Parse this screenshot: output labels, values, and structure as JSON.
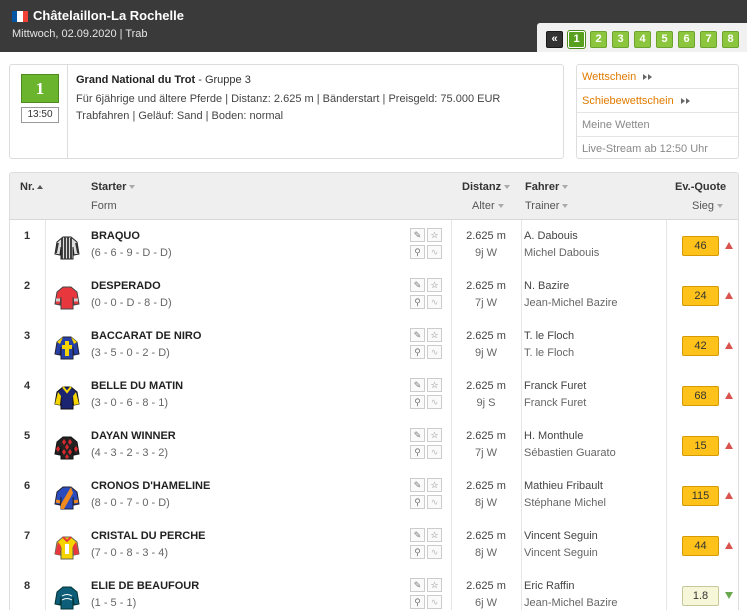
{
  "header": {
    "venue": "Châtelaillon-La Rochelle",
    "subline": "Mittwoch, 02.09.2020  |  Trab",
    "flag_colors": [
      "#0055a4",
      "#ffffff",
      "#ef4135"
    ],
    "prev_label": "«",
    "race_numbers": [
      "1",
      "2",
      "3",
      "4",
      "5",
      "6",
      "7",
      "8"
    ],
    "active_race": "1"
  },
  "race": {
    "number": "1",
    "time": "13:50",
    "title": "Grand National du Trot",
    "group": " - Gruppe 3",
    "line2": "Für 6jährige und ältere Pferde  |  Distanz: 2.625 m  |  Bänderstart  |  Preisgeld: 75.000 EUR",
    "line3": "Trabfahren  |  Geläuf: Sand  |  Boden: normal"
  },
  "sidebar": {
    "items": [
      {
        "label": "Wettschein",
        "style": "orange",
        "icon": "double-chevron-right-icon"
      },
      {
        "label": "Schiebewettschein",
        "style": "orange",
        "icon": "double-chevron-right-icon"
      },
      {
        "label": "Meine Wetten",
        "style": "gray"
      },
      {
        "label": "Live-Stream ab 12:50 Uhr",
        "style": "gray"
      }
    ]
  },
  "table": {
    "headers": {
      "nr": "Nr.",
      "starter": "Starter",
      "form": "Form",
      "distanz": "Distanz",
      "alter": "Alter",
      "fahrer": "Fahrer",
      "trainer": "Trainer",
      "quote": "Ev.-Quote",
      "sieg": "Sieg"
    },
    "rows": [
      {
        "nr": "1",
        "name": "BRAQUO",
        "form": "(6 - 6 - 9 - D - D)",
        "dist": "2.625 m",
        "age": "9j W",
        "driver": "A. Dabouis",
        "trainer": "Michel Dabouis",
        "odds": "46",
        "trend": "up",
        "silk": "stripes"
      },
      {
        "nr": "2",
        "name": "DESPERADO",
        "form": "(0 - 0 - D - 8 - D)",
        "dist": "2.625 m",
        "age": "7j W",
        "driver": "N. Bazire",
        "trainer": "Jean-Michel Bazire",
        "odds": "24",
        "trend": "up",
        "silk": "red"
      },
      {
        "nr": "3",
        "name": "BACCARAT DE NIRO",
        "form": "(3 - 5 - 0 - 2 - D)",
        "dist": "2.625 m",
        "age": "9j W",
        "driver": "T. le Floch",
        "trainer": "T. le Floch",
        "odds": "42",
        "trend": "up",
        "silk": "blue-yellow-cross"
      },
      {
        "nr": "4",
        "name": "BELLE DU MATIN",
        "form": "(3 - 0 - 6 - 8 - 1)",
        "dist": "2.625 m",
        "age": "9j S",
        "driver": "Franck Furet",
        "trainer": "Franck Furet",
        "odds": "68",
        "trend": "up",
        "silk": "navy-yellow"
      },
      {
        "nr": "5",
        "name": "DAYAN WINNER",
        "form": "(4 - 3 - 2 - 3 - 2)",
        "dist": "2.625 m",
        "age": "7j W",
        "driver": "H. Monthule",
        "trainer": "Sébastien Guarato",
        "odds": "15",
        "trend": "up",
        "silk": "diamonds"
      },
      {
        "nr": "6",
        "name": "CRONOS D'HAMELINE",
        "form": "(8 - 0 - 7 - 0 - D)",
        "dist": "2.625 m",
        "age": "8j W",
        "driver": "Mathieu Fribault",
        "trainer": "Stéphane Michel",
        "odds": "115",
        "trend": "up",
        "silk": "blue-orange-sash"
      },
      {
        "nr": "7",
        "name": "CRISTAL DU PERCHE",
        "form": "(7 - 0 - 8 - 3 - 4)",
        "dist": "2.625 m",
        "age": "8j W",
        "driver": "Vincent Seguin",
        "trainer": "Vincent Seguin",
        "odds": "44",
        "trend": "up",
        "silk": "yellow-red"
      },
      {
        "nr": "8",
        "name": "ELIE DE BEAUFOUR",
        "form": "(1 - 5 - 1)",
        "dist": "2.625 m",
        "age": "6j W",
        "driver": "Eric Raffin",
        "trainer": "Jean-Michel Bazire",
        "odds": "1.8",
        "trend": "down",
        "silk": "teal"
      }
    ]
  },
  "colors": {
    "accent_green": "#8cc63e",
    "odds_orange": "#ffc21a",
    "link_orange": "#e07b00",
    "trend_up": "#d9534f",
    "trend_down": "#6aa84f"
  }
}
